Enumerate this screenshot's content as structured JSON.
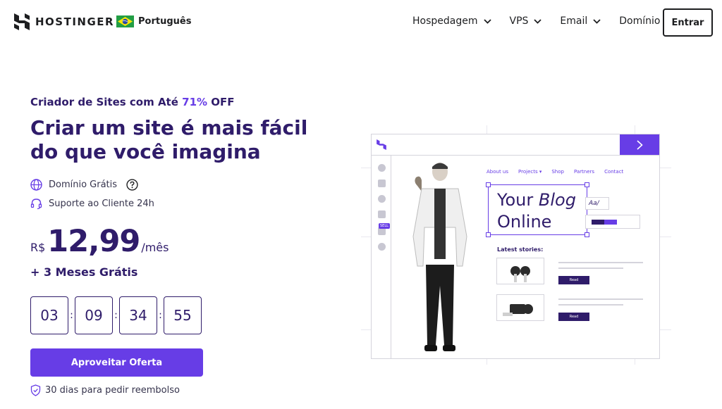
{
  "brand": {
    "name": "HOSTINGER"
  },
  "language": {
    "label": "Português",
    "flag": "brazil"
  },
  "nav": {
    "items": [
      {
        "label": "Hospedagem"
      },
      {
        "label": "VPS"
      },
      {
        "label": "Email"
      },
      {
        "label": "Domínio"
      }
    ],
    "login_label": "Entrar"
  },
  "hero": {
    "eyebrow_prefix": "Criador de Sites com Até ",
    "eyebrow_discount": "71%",
    "eyebrow_suffix": " OFF",
    "headline": "Criar um site é mais fácil do que você imagina",
    "features": [
      {
        "label": "Domínio Grátis",
        "icon": "globe-icon"
      },
      {
        "label": "Suporte ao Cliente 24h",
        "icon": "headset-icon"
      }
    ],
    "price": {
      "currency": "R$",
      "amount": "12,99",
      "period": "/mês"
    },
    "bonus": "+ 3 Meses Grátis",
    "countdown": [
      "03",
      "09",
      "34",
      "55"
    ],
    "countdown_separator": ":",
    "cta_label": "Aproveitar Oferta",
    "guarantee": "30 dias para pedir reembolso"
  },
  "illustration": {
    "site_nav": [
      "About us",
      "Projects ▾",
      "Shop",
      "Partners",
      "Contact"
    ],
    "blog_title_line1_plain": "Your ",
    "blog_title_line1_italic": "Blog",
    "blog_title_line2": "Online",
    "font_control": "Aa/",
    "latest_label": "Latest stories:",
    "read_label": "Read",
    "sell_tag": "SELL"
  },
  "colors": {
    "primary": "#673de6",
    "dark": "#2f1c6a",
    "text": "#1d1e20"
  }
}
